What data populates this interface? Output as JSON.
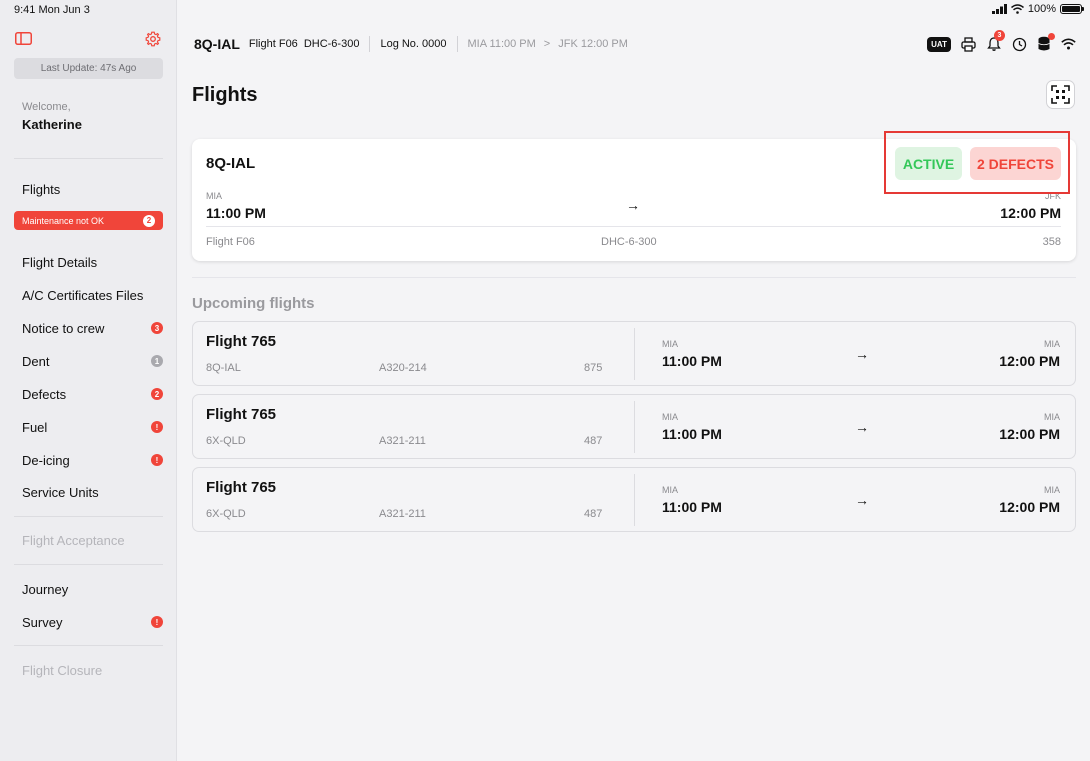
{
  "status_bar": {
    "time": "9:41 Mon Jun 3",
    "battery": "100%"
  },
  "sidebar": {
    "last_update": "Last Update: 47s Ago",
    "welcome": "Welcome,",
    "user": "Katherine",
    "flights_label": "Flights",
    "maintenance": {
      "label": "Maintenance not OK",
      "count": "2"
    },
    "items": [
      {
        "label": "Flight Details",
        "badge": ""
      },
      {
        "label": "A/C Certificates Files",
        "badge": ""
      },
      {
        "label": "Notice to crew",
        "badge": "3",
        "badge_color": "red"
      },
      {
        "label": "Dent",
        "badge": "1",
        "badge_color": "grey"
      },
      {
        "label": "Defects",
        "badge": "2",
        "badge_color": "red"
      },
      {
        "label": "Fuel",
        "badge": "!",
        "badge_color": "red"
      },
      {
        "label": "De-icing",
        "badge": "!",
        "badge_color": "red"
      },
      {
        "label": "Service Units",
        "badge": ""
      }
    ],
    "flight_acceptance": "Flight Acceptance",
    "journey": "Journey",
    "survey": {
      "label": "Survey",
      "badge": "!"
    },
    "flight_closure": "Flight Closure"
  },
  "topbar": {
    "registration": "8Q-IAL",
    "flight": "Flight F06",
    "aircraft_type": "DHC-6-300",
    "log_no": "Log No. 0000",
    "from": "MIA 11:00 PM",
    "route_sep": ">",
    "to": "JFK 12:00 PM",
    "uat_label": "UAT",
    "notification_count": "3"
  },
  "page": {
    "title": "Flights",
    "upcoming_title": "Upcoming flights"
  },
  "active_flight": {
    "registration": "8Q-IAL",
    "status": "ACTIVE",
    "defects": "2 DEFECTS",
    "from_code": "MIA",
    "from_time": "11:00 PM",
    "arrow": "→",
    "to_code": "JFK",
    "to_time": "12:00 PM",
    "flight": "Flight F06",
    "aircraft_type": "DHC-6-300",
    "number": "358"
  },
  "upcoming": [
    {
      "flight": "Flight 765",
      "registration": "8Q-IAL",
      "aircraft_type": "A320-214",
      "number": "875",
      "from_code": "MIA",
      "from_time": "11:00 PM",
      "arrow": "→",
      "to_code": "MIA",
      "to_time": "12:00 PM"
    },
    {
      "flight": "Flight 765",
      "registration": "6X-QLD",
      "aircraft_type": "A321-211",
      "number": "487",
      "from_code": "MIA",
      "from_time": "11:00 PM",
      "arrow": "→",
      "to_code": "MIA",
      "to_time": "12:00 PM"
    },
    {
      "flight": "Flight 765",
      "registration": "6X-QLD",
      "aircraft_type": "A321-211",
      "number": "487",
      "from_code": "MIA",
      "from_time": "11:00 PM",
      "arrow": "→",
      "to_code": "MIA",
      "to_time": "12:00 PM"
    }
  ],
  "colors": {
    "accent_red": "#f0453a",
    "active_green": "#34c759",
    "highlight": "#e53935"
  },
  "icons": [
    "sidebar-toggle-icon",
    "gear-icon",
    "printer-icon",
    "bell-icon",
    "history-icon",
    "database-icon",
    "wifi-icon",
    "scan-icon",
    "signal-icon",
    "battery-icon"
  ]
}
